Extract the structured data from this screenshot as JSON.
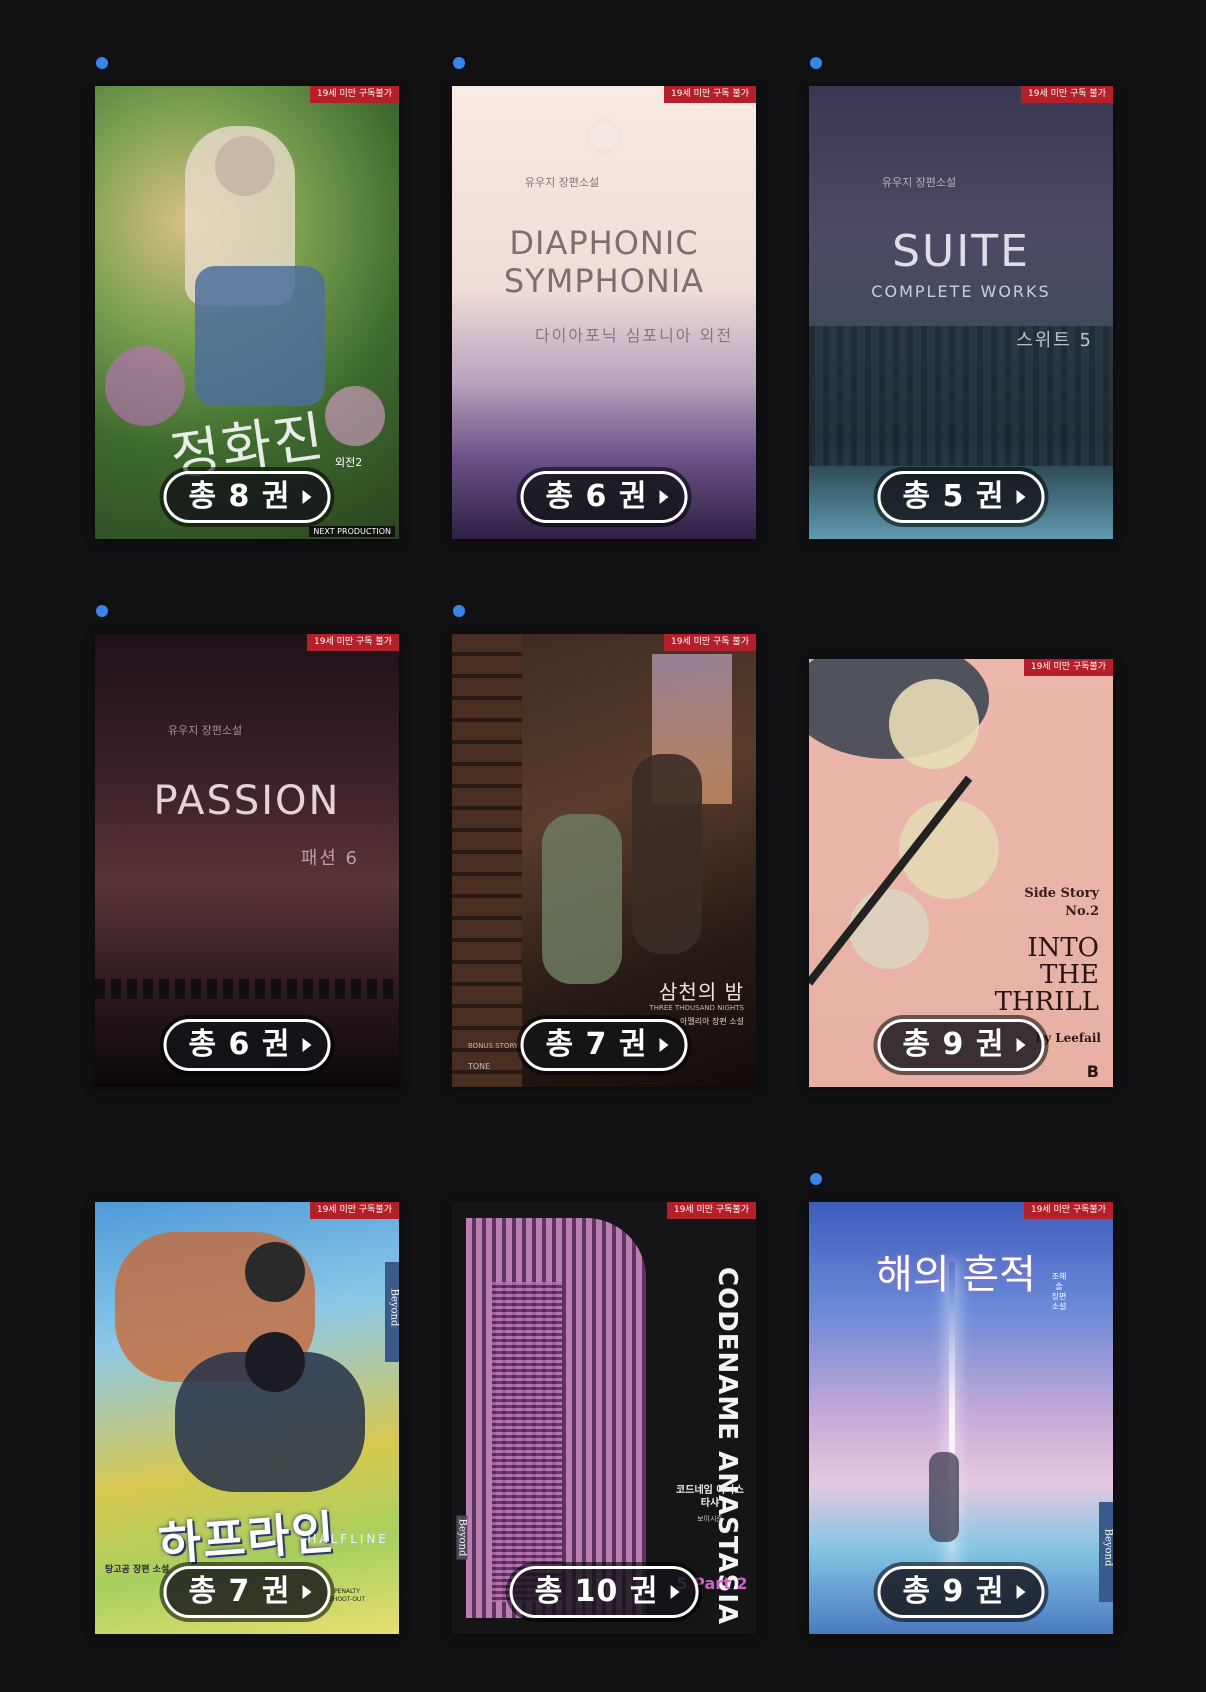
{
  "books": [
    {
      "count_label": "총 8 권",
      "age_label": "19세 미만 구독불가",
      "title_ko": "정화진",
      "sub": "외전2",
      "author": "",
      "title_en": "",
      "publisher": "NEXT PRODUCTION",
      "colors": [
        "#3a5a2a",
        "#7a9a4a",
        "#c8a86a"
      ],
      "has_dot": true
    },
    {
      "count_label": "총 6 권",
      "age_label": "19세 미만 구독 불가",
      "title_en": "DIAPHONIC SYMPHONIA",
      "title_ko": "다이아포닉 심포니아 외전",
      "author": "유우지 장편소설",
      "publisher": "",
      "colors": [
        "#f6e6dc",
        "#c9b3c0",
        "#4a3462"
      ],
      "has_dot": true
    },
    {
      "count_label": "총 5 권",
      "age_label": "19세 미만 구독 불가",
      "title_en": "SUITE",
      "sub": "COMPLETE WORKS",
      "title_ko": "스위트 5",
      "author": "유우지 장편소설",
      "publisher": "",
      "colors": [
        "#3e3e58",
        "#4e5670",
        "#3e6a80"
      ],
      "has_dot": true
    },
    {
      "count_label": "총 6 권",
      "age_label": "19세 미만 구독 불가",
      "title_en": "PASSION",
      "title_ko": "패션 6",
      "author": "유우지 장편소설",
      "publisher": "",
      "colors": [
        "#2a1820",
        "#4e2c30",
        "#120e12"
      ],
      "has_dot": true
    },
    {
      "count_label": "총 7 권",
      "age_label": "19세 미만 구독 불가",
      "title_ko": "삼천의 밤",
      "title_en": "THREE THOUSAND NIGHTS",
      "author": "아멜리아 장편 소설",
      "sub": "BONUS STORY",
      "publisher": "TONE",
      "colors": [
        "#2a1c16",
        "#5a3a2a",
        "#1c1410"
      ],
      "has_dot": true
    },
    {
      "count_label": "총 9 권",
      "age_label": "19세 미만 구독불가",
      "title_en": "INTO THE THRILL",
      "sub": "Side Story No.2",
      "author": "by Leefail",
      "publisher": "B",
      "colors": [
        "#e8b4a8",
        "#f0c2b4",
        "#e4aa9c"
      ],
      "has_dot": false
    },
    {
      "count_label": "총 7 권",
      "age_label": "19세 미만 구독불가",
      "title_ko": "하프라인",
      "title_en": "HALFLINE",
      "sub": "PENALTY SHOOT-OUT",
      "author": "탕고공 장편 소설",
      "publisher": "Beyond",
      "colors": [
        "#4c9ad8",
        "#e4d04a",
        "#a0c858"
      ],
      "has_dot": false
    },
    {
      "count_label": "총 10 권",
      "age_label": "19세 미만 구독불가",
      "title_en": "CODENAME ANASTASIA",
      "title_ko": "코드네임 아나스타샤",
      "author": "보이시즌",
      "sub": "5 Part 2",
      "publisher": "Beyond",
      "colors": [
        "#1a1a1e",
        "#c880c0",
        "#121214"
      ],
      "has_dot": false
    },
    {
      "count_label": "총 9 권",
      "age_label": "19세 미만 구독불가",
      "title_ko": "해의 흔적",
      "author": "조해솔 장편소설",
      "publisher": "Beyond",
      "colors": [
        "#4868c8",
        "#c8a8d8",
        "#7cc0e0"
      ],
      "has_dot": true
    }
  ]
}
